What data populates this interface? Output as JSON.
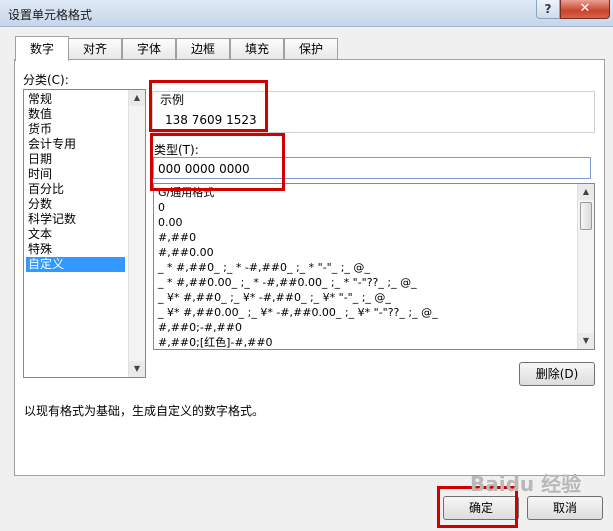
{
  "window": {
    "title": "设置单元格格式",
    "help_label": "?",
    "close_label": "✕"
  },
  "tabs": [
    {
      "label": "数字"
    },
    {
      "label": "对齐"
    },
    {
      "label": "字体"
    },
    {
      "label": "边框"
    },
    {
      "label": "填充"
    },
    {
      "label": "保护"
    }
  ],
  "category": {
    "label": "分类(C):",
    "items": [
      "常规",
      "数值",
      "货币",
      "会计专用",
      "日期",
      "时间",
      "百分比",
      "分数",
      "科学记数",
      "文本",
      "特殊",
      "自定义"
    ],
    "selected": "自定义"
  },
  "sample": {
    "label": "示例",
    "value": "138 7609 1523"
  },
  "type": {
    "label": "类型(T):",
    "value": "000 0000 0000",
    "formats": [
      "G/通用格式",
      "0",
      "0.00",
      "#,##0",
      "#,##0.00",
      "_ * #,##0_ ;_ * -#,##0_ ;_ * \"-\"_ ;_ @_",
      "_ * #,##0.00_ ;_ * -#,##0.00_ ;_ * \"-\"??_ ;_ @_",
      "_ ¥* #,##0_ ;_ ¥* -#,##0_ ;_ ¥* \"-\"_ ;_ @_",
      "_ ¥* #,##0.00_ ;_ ¥* -#,##0.00_ ;_ ¥* \"-\"??_ ;_ @_",
      "#,##0;-#,##0",
      "#,##0;[红色]-#,##0"
    ]
  },
  "delete_button": "删除(D)",
  "description": "以现有格式为基础，生成自定义的数字格式。",
  "ok_button": "确定",
  "cancel_button": "取消",
  "watermark": "Baidu 经验",
  "colors": {
    "highlight": "#d00000",
    "selection": "#3399ff"
  },
  "icons": {
    "help": "help-icon",
    "close": "close-icon"
  }
}
